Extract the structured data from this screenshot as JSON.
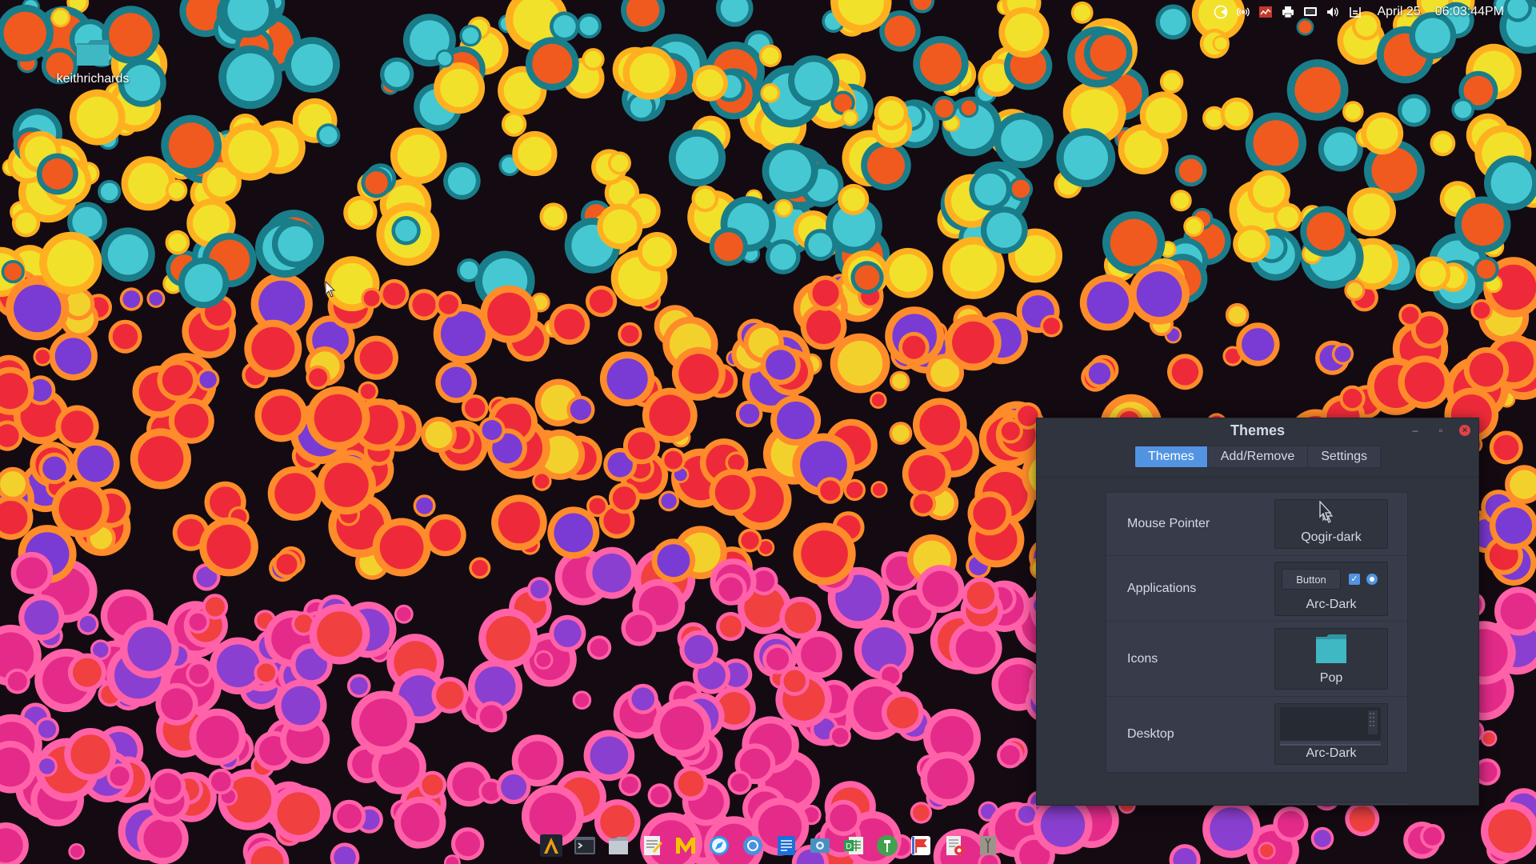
{
  "top_panel": {
    "tray_icons": [
      "pacman-monitor-icon",
      "network-wireless-icon",
      "cpu-monitor-icon",
      "printer-icon",
      "display-icon",
      "volume-icon",
      "battery-icon"
    ],
    "date": "April 25",
    "time": "06:03:44PM"
  },
  "desktop": {
    "home_folder_label": "keithrichards"
  },
  "window": {
    "title": "Themes",
    "tabs": [
      {
        "label": "Themes",
        "active": true
      },
      {
        "label": "Add/Remove",
        "active": false
      },
      {
        "label": "Settings",
        "active": false
      }
    ],
    "rows": [
      {
        "label": "Mouse Pointer",
        "value": "Qogir-dark"
      },
      {
        "label": "Applications",
        "value": "Arc-Dark",
        "sample_button": "Button"
      },
      {
        "label": "Icons",
        "value": "Pop"
      },
      {
        "label": "Desktop",
        "value": "Arc-Dark"
      }
    ]
  },
  "dock": {
    "icons": [
      "arch-launcher-icon",
      "terminal-icon",
      "file-manager-icon",
      "text-editor-icon",
      "mail-icon",
      "web-browser-icon",
      "chromium-icon",
      "office-writer-icon",
      "screenshot-icon",
      "spreadsheet-icon",
      "ms-office-icon",
      "flag-app-icon",
      "document-viewer-icon",
      "archive-manager-icon"
    ]
  },
  "colors": {
    "accent": "#5294e2",
    "window_bg": "#2f343f",
    "panel_bg": "#383c4a",
    "close_red": "#e14245",
    "folder_teal": "#3fb8c4"
  }
}
